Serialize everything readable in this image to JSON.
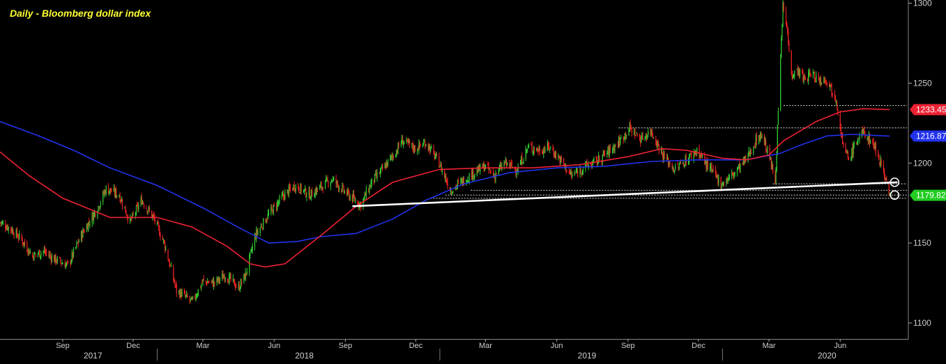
{
  "chart_data": {
    "type": "candlestick",
    "title": "Daily - Bloomberg dollar index",
    "ylim": [
      1090,
      1302
    ],
    "y_ticks": [
      1100,
      1150,
      1200,
      1250,
      1300
    ],
    "x_ticks": [
      {
        "date": "2017-09-01",
        "label": "Sep"
      },
      {
        "date": "2017-12-01",
        "label": "Dec"
      },
      {
        "date": "2018-03-01",
        "label": "Mar"
      },
      {
        "date": "2018-06-01",
        "label": "Jun"
      },
      {
        "date": "2018-09-01",
        "label": "Sep"
      },
      {
        "date": "2018-12-01",
        "label": "Dec"
      },
      {
        "date": "2019-03-01",
        "label": "Mar"
      },
      {
        "date": "2019-06-01",
        "label": "Jun"
      },
      {
        "date": "2019-09-01",
        "label": "Sep"
      },
      {
        "date": "2019-12-01",
        "label": "Dec"
      },
      {
        "date": "2020-03-01",
        "label": "Mar"
      },
      {
        "date": "2020-06-01",
        "label": "Jun"
      }
    ],
    "year_labels": [
      {
        "label": "2017",
        "date": "2017-10-10"
      },
      {
        "label": "2018",
        "date": "2018-07-10"
      },
      {
        "label": "2019",
        "date": "2019-07-10"
      },
      {
        "label": "2020",
        "date": "2020-05-15"
      }
    ],
    "price_path": [
      [
        "2017-06-12",
        1163
      ],
      [
        "2017-06-26",
        1159
      ],
      [
        "2017-07-10",
        1152
      ],
      [
        "2017-07-24",
        1142
      ],
      [
        "2017-08-07",
        1145
      ],
      [
        "2017-08-21",
        1140
      ],
      [
        "2017-09-08",
        1136
      ],
      [
        "2017-09-25",
        1155
      ],
      [
        "2017-10-16",
        1172
      ],
      [
        "2017-10-27",
        1184
      ],
      [
        "2017-11-13",
        1180
      ],
      [
        "2017-11-27",
        1163
      ],
      [
        "2017-12-12",
        1177
      ],
      [
        "2017-12-28",
        1165
      ],
      [
        "2018-01-10",
        1150
      ],
      [
        "2018-01-26",
        1120
      ],
      [
        "2018-02-02",
        1118
      ],
      [
        "2018-02-15",
        1113
      ],
      [
        "2018-03-01",
        1126
      ],
      [
        "2018-03-16",
        1125
      ],
      [
        "2018-03-30",
        1130
      ],
      [
        "2018-04-16",
        1122
      ],
      [
        "2018-04-25",
        1130
      ],
      [
        "2018-05-08",
        1155
      ],
      [
        "2018-05-25",
        1168
      ],
      [
        "2018-06-14",
        1180
      ],
      [
        "2018-06-28",
        1186
      ],
      [
        "2018-07-17",
        1180
      ],
      [
        "2018-08-03",
        1186
      ],
      [
        "2018-08-15",
        1190
      ],
      [
        "2018-08-31",
        1182
      ],
      [
        "2018-09-21",
        1174
      ],
      [
        "2018-10-05",
        1188
      ],
      [
        "2018-10-19",
        1196
      ],
      [
        "2018-11-05",
        1207
      ],
      [
        "2018-11-13",
        1214
      ],
      [
        "2018-11-30",
        1209
      ],
      [
        "2018-12-14",
        1213
      ],
      [
        "2018-12-31",
        1200
      ],
      [
        "2019-01-15",
        1183
      ],
      [
        "2019-01-31",
        1189
      ],
      [
        "2019-02-14",
        1194
      ],
      [
        "2019-02-28",
        1198
      ],
      [
        "2019-03-12",
        1192
      ],
      [
        "2019-03-26",
        1200
      ],
      [
        "2019-04-11",
        1196
      ],
      [
        "2019-04-25",
        1210
      ],
      [
        "2019-05-10",
        1208
      ],
      [
        "2019-05-23",
        1210
      ],
      [
        "2019-06-07",
        1201
      ],
      [
        "2019-06-20",
        1192
      ],
      [
        "2019-07-08",
        1198
      ],
      [
        "2019-07-22",
        1201
      ],
      [
        "2019-08-06",
        1207
      ],
      [
        "2019-08-20",
        1213
      ],
      [
        "2019-09-03",
        1222
      ],
      [
        "2019-09-17",
        1215
      ],
      [
        "2019-10-01",
        1220
      ],
      [
        "2019-10-16",
        1205
      ],
      [
        "2019-10-31",
        1196
      ],
      [
        "2019-11-15",
        1202
      ],
      [
        "2019-11-29",
        1208
      ],
      [
        "2019-12-13",
        1198
      ],
      [
        "2019-12-31",
        1187
      ],
      [
        "2020-01-15",
        1193
      ],
      [
        "2020-01-31",
        1202
      ],
      [
        "2020-02-14",
        1215
      ],
      [
        "2020-02-21",
        1218
      ],
      [
        "2020-03-03",
        1201
      ],
      [
        "2020-03-09",
        1188
      ],
      [
        "2020-03-13",
        1232
      ],
      [
        "2020-03-19",
        1298
      ],
      [
        "2020-03-24",
        1285
      ],
      [
        "2020-03-31",
        1255
      ],
      [
        "2020-04-07",
        1258
      ],
      [
        "2020-04-16",
        1252
      ],
      [
        "2020-04-24",
        1256
      ],
      [
        "2020-05-06",
        1252
      ],
      [
        "2020-05-14",
        1253
      ],
      [
        "2020-05-27",
        1240
      ],
      [
        "2020-06-05",
        1210
      ],
      [
        "2020-06-12",
        1202
      ],
      [
        "2020-06-22",
        1214
      ],
      [
        "2020-07-01",
        1219
      ],
      [
        "2020-07-14",
        1212
      ],
      [
        "2020-07-24",
        1200
      ],
      [
        "2020-07-31",
        1188
      ],
      [
        "2020-08-04",
        1180
      ]
    ],
    "ma_red": [
      [
        "2017-06-12",
        1207
      ],
      [
        "2017-07-20",
        1192
      ],
      [
        "2017-09-01",
        1178
      ],
      [
        "2017-11-01",
        1166
      ],
      [
        "2018-01-01",
        1166
      ],
      [
        "2018-02-15",
        1160
      ],
      [
        "2018-04-01",
        1148
      ],
      [
        "2018-05-01",
        1137
      ],
      [
        "2018-05-20",
        1135
      ],
      [
        "2018-06-15",
        1137
      ],
      [
        "2018-08-01",
        1155
      ],
      [
        "2018-09-15",
        1173
      ],
      [
        "2018-11-01",
        1188
      ],
      [
        "2018-12-31",
        1196
      ],
      [
        "2019-03-01",
        1197
      ],
      [
        "2019-05-01",
        1197
      ],
      [
        "2019-07-01",
        1199
      ],
      [
        "2019-09-01",
        1204
      ],
      [
        "2019-10-15",
        1209
      ],
      [
        "2019-11-15",
        1208
      ],
      [
        "2020-01-01",
        1203
      ],
      [
        "2020-02-01",
        1202
      ],
      [
        "2020-03-01",
        1205
      ],
      [
        "2020-03-20",
        1214
      ],
      [
        "2020-05-01",
        1226
      ],
      [
        "2020-06-01",
        1232
      ],
      [
        "2020-07-01",
        1234
      ],
      [
        "2020-08-04",
        1233.45
      ]
    ],
    "ma_blue": [
      [
        "2017-06-12",
        1226
      ],
      [
        "2017-08-01",
        1217
      ],
      [
        "2017-09-15",
        1208
      ],
      [
        "2017-11-01",
        1197
      ],
      [
        "2018-01-01",
        1186
      ],
      [
        "2018-03-01",
        1172
      ],
      [
        "2018-04-15",
        1160
      ],
      [
        "2018-05-25",
        1150
      ],
      [
        "2018-07-01",
        1151
      ],
      [
        "2018-08-01",
        1154
      ],
      [
        "2018-09-15",
        1156
      ],
      [
        "2018-11-01",
        1165
      ],
      [
        "2018-12-15",
        1177
      ],
      [
        "2019-02-01",
        1187
      ],
      [
        "2019-04-01",
        1194
      ],
      [
        "2019-06-01",
        1197
      ],
      [
        "2019-08-01",
        1198
      ],
      [
        "2019-10-01",
        1201
      ],
      [
        "2019-12-01",
        1202
      ],
      [
        "2020-02-01",
        1202
      ],
      [
        "2020-03-15",
        1206
      ],
      [
        "2020-04-15",
        1212
      ],
      [
        "2020-05-15",
        1217
      ],
      [
        "2020-06-15",
        1218
      ],
      [
        "2020-08-04",
        1216.87
      ]
    ],
    "trendline": {
      "from": [
        "2018-09-10",
        1173
      ],
      "to": [
        "2020-08-14",
        1188
      ]
    },
    "levels": [
      {
        "from": "2020-03-20",
        "value": 1236
      },
      {
        "from": "2019-08-20",
        "value": 1222
      },
      {
        "from": "2020-03-06",
        "value": 1187
      },
      {
        "from": "2019-02-10",
        "value": 1183
      },
      {
        "from": "2019-01-08",
        "value": 1180
      },
      {
        "from": "2018-12-20",
        "value": 1178
      }
    ],
    "circles": [
      {
        "date": "2020-08-04",
        "value": 1188
      },
      {
        "date": "2020-08-04",
        "value": 1180
      }
    ],
    "value_tags": [
      {
        "value": 1233.45,
        "label": "1233.45",
        "color": "#ee2233"
      },
      {
        "value": 1216.87,
        "label": "1216.87",
        "color": "#2233ee"
      },
      {
        "value": 1179.82,
        "label": "1179.82",
        "color": "#22cc22"
      }
    ],
    "colors": {
      "background": "#000000",
      "up": "#33cc33",
      "down": "#ee2222",
      "ma_red": "#ee2233",
      "ma_blue": "#2233ee",
      "trendline": "#ffffff"
    }
  }
}
